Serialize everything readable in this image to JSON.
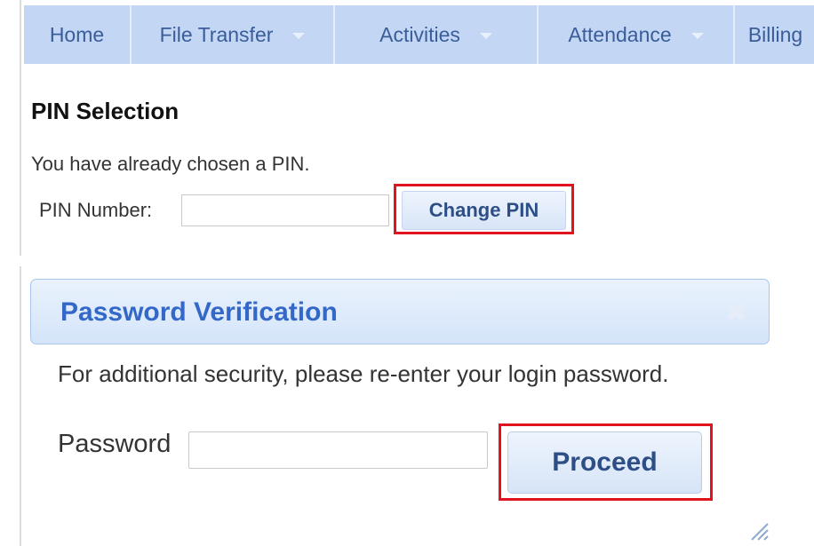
{
  "nav": {
    "items": [
      {
        "label": "Home",
        "has_dropdown": false
      },
      {
        "label": "File Transfer",
        "has_dropdown": true
      },
      {
        "label": "Activities",
        "has_dropdown": true
      },
      {
        "label": "Attendance",
        "has_dropdown": true
      },
      {
        "label": "Billing",
        "has_dropdown": false
      }
    ]
  },
  "pin": {
    "title": "PIN Selection",
    "info": "You have already chosen a PIN.",
    "number_label": "PIN Number:",
    "number_value": "",
    "change_button": "Change PIN"
  },
  "dialog": {
    "title": "Password Verification",
    "close_icon": "close-icon",
    "message": "For additional security, please re-enter your login password.",
    "password_label": "Password",
    "password_value": "",
    "proceed_button": "Proceed"
  },
  "colors": {
    "nav_bg": "#c3d7f5",
    "nav_text": "#3a5d9a",
    "dialog_title": "#3468c8",
    "highlight": "#e0141e",
    "button_text": "#2e4f85"
  }
}
